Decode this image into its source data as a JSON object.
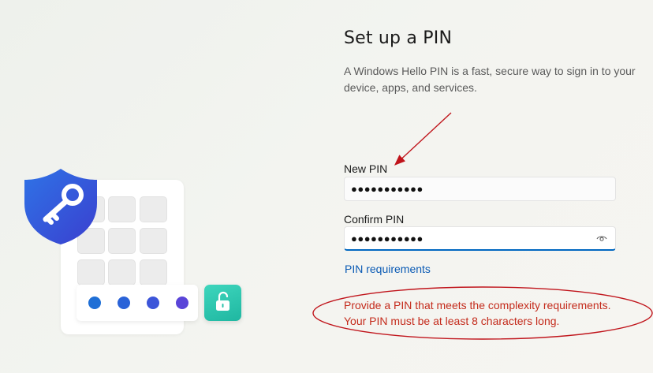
{
  "page": {
    "title": "Set up a PIN",
    "description": "A Windows Hello PIN is a fast, secure way to sign in to your device, apps, and services."
  },
  "form": {
    "new_pin_label": "New PIN",
    "new_pin_value": "●●●●●●●●●●●",
    "confirm_pin_label": "Confirm PIN",
    "confirm_pin_value": "●●●●●●●●●●●",
    "requirements_link": "PIN requirements",
    "error_message": "Provide a PIN that meets the complexity requirements. Your PIN must be at least 8 characters long."
  },
  "illustration": {
    "dot_colors": [
      "#1f6fd6",
      "#2a63d8",
      "#3c55d9",
      "#5a45d8"
    ],
    "shield_color": "#2f56d6",
    "lock_tile_color": "#27c2aa"
  },
  "annotations": {
    "arrow_color": "#c0141b",
    "ellipse_color": "#c0141b"
  },
  "icons": [
    "key-icon",
    "shield-icon",
    "unlock-icon",
    "eye-icon"
  ]
}
